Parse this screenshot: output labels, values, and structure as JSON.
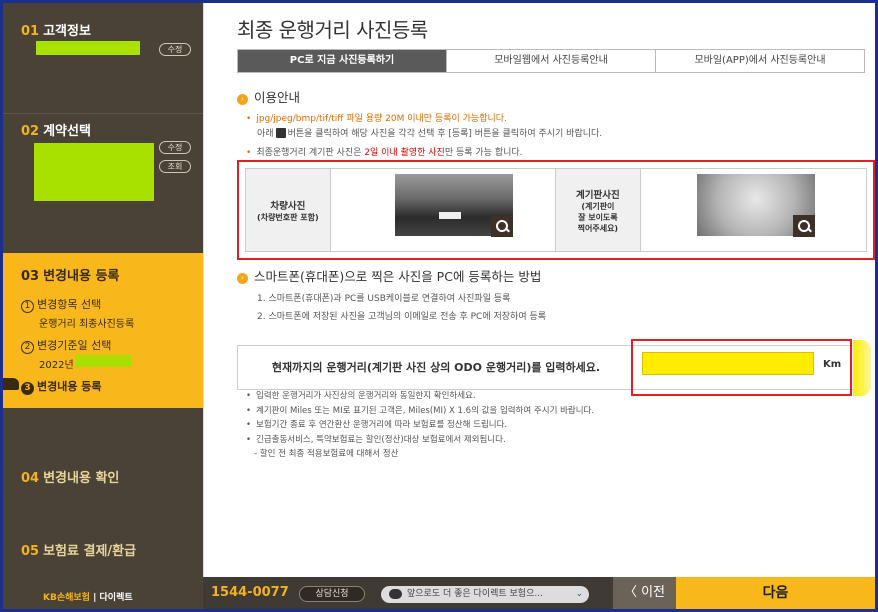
{
  "sidebar": {
    "step1": {
      "num": "01",
      "label": "고객정보",
      "pill": "수정"
    },
    "step2": {
      "num": "02",
      "label": "계약선택",
      "pill_edit": "수정",
      "pill_view": "조회"
    },
    "step3": {
      "num": "03",
      "label": "변경내용 등록",
      "subs": [
        {
          "num": "1",
          "label": "변경항목 선택",
          "note": "운행거리 최종사진등록"
        },
        {
          "num": "2",
          "label": "변경기준일 선택",
          "note": "2022년"
        },
        {
          "num": "3",
          "label": "변경내용 등록"
        }
      ]
    },
    "step4": {
      "num": "04",
      "label": "변경내용 확인"
    },
    "step5": {
      "num": "05",
      "label": "보험료 결제/환급"
    },
    "brand": {
      "logo": "KB손해보험",
      "suffix": "| 다이렉트"
    }
  },
  "main": {
    "title": "최종 운행거리 사진등록",
    "tabs": [
      "PC로 지금 사진등록하기",
      "모바일웹에서 사진등록안내",
      "모바일(APP)에서 사진등록안내"
    ],
    "usage_head": "이용안내",
    "usage": {
      "line1": "jpg/jpeg/bmp/tif/tiff 파일 용량 20M 이내만 등록이 가능합니다.",
      "line2a": "아래",
      "line2b": "버튼을 클릭하여 해당 사진을 각각 선택 후 [등록] 버튼을 클릭하여 주시기 바랍니다.",
      "line3a": "최종운행거리 계기판 사진은",
      "line3b": "2일 이내 촬영한 사진",
      "line3c": "만 등록 가능 합니다."
    },
    "photos": {
      "car_label": "차량사진",
      "car_sub": "(차량번호판 포함)",
      "dash_label": "계기판사진",
      "dash_sub1": "(계기판이",
      "dash_sub2": "잘 보이도록",
      "dash_sub3": "찍어주세요)"
    },
    "phone_head": "스마트폰(휴대폰)으로 찍은 사진을 PC에 등록하는 방법",
    "phone_steps": [
      "1. 스마트폰(휴대폰)과 PC를 USB케이블로 연결하여 사진파일 등록",
      "2. 스마트폰에 저장된 사진을 고객님의 이메일로 전송 후 PC에 저장하여 등록"
    ],
    "odo": {
      "label": "현재까지의 운행거리(계기판 사진 상의 ODO 운행거리)를 입력하세요.",
      "value": "",
      "unit": "Km"
    },
    "notes": [
      "입력한 운행거리가 사진상의 운행거리와 동일한지 확인하세요.",
      "계기판이 Miles 또는 MI로 표기된 고객은, Miles(MI) X 1.6의 값을 입력하여 주시기 바랍니다.",
      "보험기간 종료 후 연간환산 운행거리에 따라 보험료를 정산해 드립니다.",
      "긴급출동서비스, 특약보험료는 할인(정산)대상 보험료에서 제외됩니다.",
      "- 할인 전 최종 적용보험료에 대해서 정산"
    ]
  },
  "bottombar": {
    "phone": "1544-0077",
    "consult": "상담신청",
    "chat": "앞으로도 더 좋은 다이렉트 보험으...",
    "prev": "〈 이전",
    "next": "다음"
  },
  "colors": {
    "accent": "#f8b81b",
    "sidebar": "#4a4236",
    "highlight": "#e31f26",
    "input": "#ffec00"
  }
}
